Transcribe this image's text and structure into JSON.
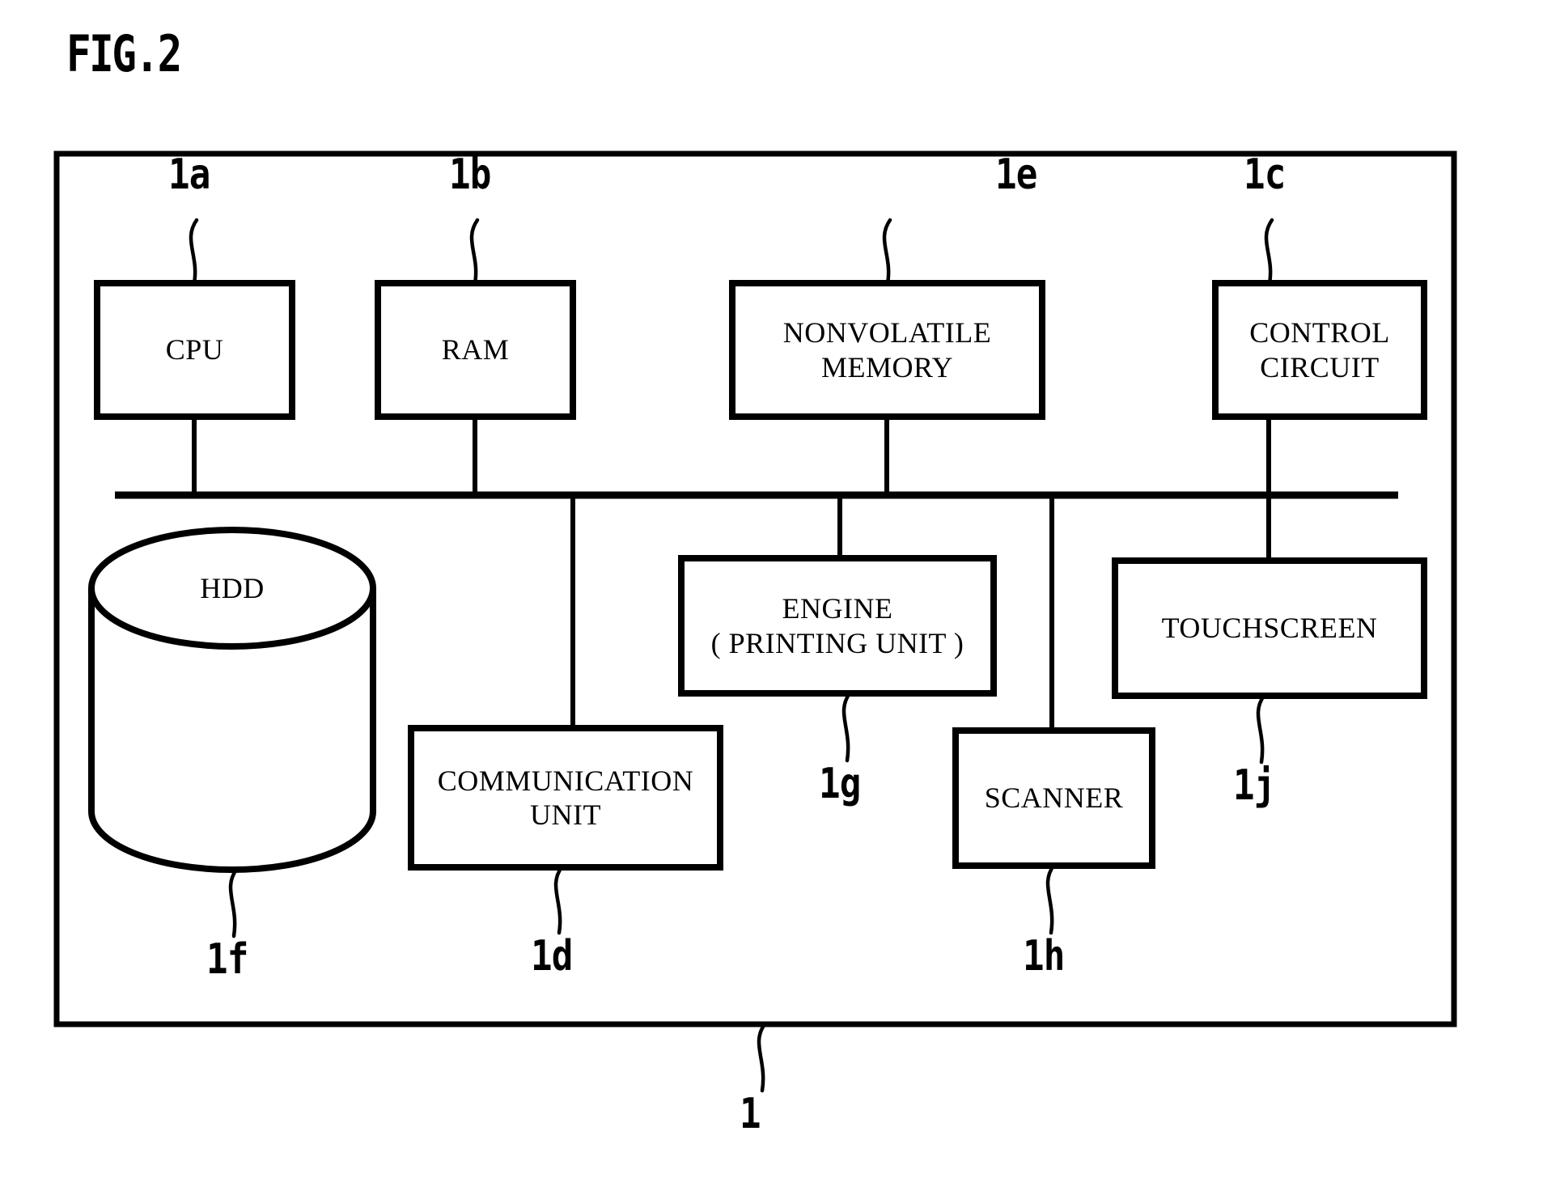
{
  "figure": {
    "title": "FIG.2",
    "outer_ref": "1"
  },
  "blocks": [
    {
      "id": "cpu",
      "label": "CPU",
      "ref": "1a"
    },
    {
      "id": "ram",
      "label": "RAM",
      "ref": "1b"
    },
    {
      "id": "nonvolatile",
      "label": "NONVOLATILE\nMEMORY",
      "ref": "1e"
    },
    {
      "id": "control",
      "label": "CONTROL\nCIRCUIT",
      "ref": "1c"
    },
    {
      "id": "hdd",
      "label": "HDD",
      "ref": "1f"
    },
    {
      "id": "communication",
      "label": "COMMUNICATION\nUNIT",
      "ref": "1d"
    },
    {
      "id": "engine",
      "label": "ENGINE\n( PRINTING UNIT )",
      "ref": "1g"
    },
    {
      "id": "scanner",
      "label": "SCANNER",
      "ref": "1h"
    },
    {
      "id": "touchscreen",
      "label": "TOUCHSCREEN",
      "ref": "1j"
    }
  ],
  "colors": {
    "ink": "#000000",
    "paper": "#ffffff"
  }
}
